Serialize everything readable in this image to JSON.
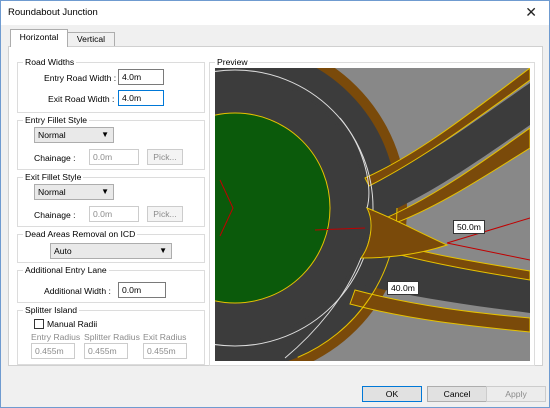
{
  "window": {
    "title": "Roundabout Junction",
    "close_glyph": "✕"
  },
  "tabs": [
    {
      "label": "Horizontal"
    },
    {
      "label": "Vertical"
    }
  ],
  "road_widths": {
    "title": "Road Widths",
    "entry_label": "Entry Road Width :",
    "entry_value": "4.0m",
    "exit_label": "Exit Road Width :",
    "exit_value": "4.0m"
  },
  "entry_fillet": {
    "title": "Entry Fillet Style",
    "style": "Normal",
    "chainage_label": "Chainage :",
    "chainage_value": "0.0m",
    "pick_label": "Pick..."
  },
  "exit_fillet": {
    "title": "Exit Fillet Style",
    "style": "Normal",
    "chainage_label": "Chainage :",
    "chainage_value": "0.0m",
    "pick_label": "Pick..."
  },
  "dead_areas": {
    "title": "Dead Areas Removal on ICD",
    "value": "Auto"
  },
  "additional_lane": {
    "title": "Additional Entry Lane",
    "width_label": "Additional Width :",
    "width_value": "0.0m"
  },
  "splitter": {
    "title": "Splitter Island",
    "manual_radii_label": "Manual Radii",
    "manual_radii_checked": false,
    "entry_radius_label": "Entry Radius",
    "entry_radius_value": "0.455m",
    "splitter_radius_label": "Splitter Radius",
    "splitter_radius_value": "0.455m",
    "exit_radius_label": "Exit Radius",
    "exit_radius_value": "0.455m"
  },
  "preview": {
    "title": "Preview",
    "dim_upper": "50.0m",
    "dim_lower": "40.0m"
  },
  "buttons": {
    "ok": "OK",
    "cancel": "Cancel",
    "apply": "Apply"
  },
  "colors": {
    "road": "#3c3c3c",
    "verge": "#7a4a0a",
    "island": "#0b5a0b",
    "edge_line": "#e6c200",
    "accent": "#0078d7"
  }
}
